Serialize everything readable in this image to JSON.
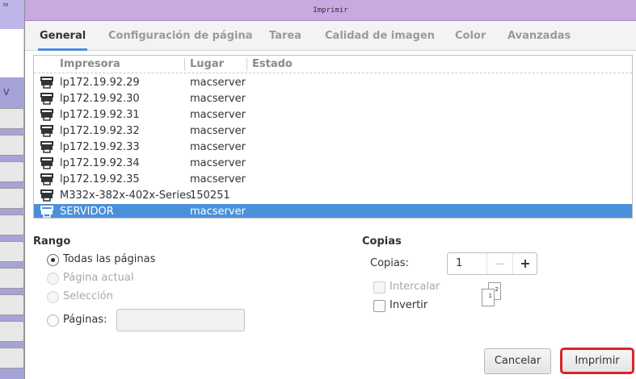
{
  "window": {
    "title": "Imprimir",
    "background_tag": "In",
    "background_letter": "V"
  },
  "tabs": [
    {
      "label": "General",
      "active": true
    },
    {
      "label": "Configuración de página",
      "active": false
    },
    {
      "label": "Tarea",
      "active": false
    },
    {
      "label": "Calidad de imagen",
      "active": false
    },
    {
      "label": "Color",
      "active": false
    },
    {
      "label": "Avanzadas",
      "active": false
    }
  ],
  "printer_list": {
    "columns": {
      "name": "Impresora",
      "location": "Lugar",
      "status": "Estado"
    },
    "rows": [
      {
        "name": "lp172.19.92.29",
        "location": "macserver",
        "selected": false
      },
      {
        "name": "lp172.19.92.30",
        "location": "macserver",
        "selected": false
      },
      {
        "name": "lp172.19.92.31",
        "location": "macserver",
        "selected": false
      },
      {
        "name": "lp172.19.92.32",
        "location": "macserver",
        "selected": false
      },
      {
        "name": "lp172.19.92.33",
        "location": "macserver",
        "selected": false
      },
      {
        "name": "lp172.19.92.34",
        "location": "macserver",
        "selected": false
      },
      {
        "name": "lp172.19.92.35",
        "location": "macserver",
        "selected": false
      },
      {
        "name": "M332x-382x-402x-Series",
        "location": "150251",
        "selected": false
      },
      {
        "name": "SERVIDOR",
        "location": "macserver",
        "selected": true
      }
    ],
    "row_icon": "printer-icon"
  },
  "range": {
    "title": "Rango",
    "options": {
      "all": {
        "label": "Todas las páginas",
        "checked": true,
        "enabled": true
      },
      "current": {
        "label": "Página actual",
        "checked": false,
        "enabled": false
      },
      "selection": {
        "label": "Selección",
        "checked": false,
        "enabled": false
      },
      "pages": {
        "label": "Páginas:",
        "checked": false,
        "enabled": true
      }
    },
    "pages_value": ""
  },
  "copies": {
    "title": "Copias",
    "label": "Copias:",
    "value": "1",
    "minus": "−",
    "plus": "+",
    "collate": {
      "label": "Intercalar",
      "checked": false,
      "enabled": false
    },
    "reverse": {
      "label": "Invertir",
      "checked": false,
      "enabled": true
    },
    "sheet_labels": [
      "1",
      "2"
    ]
  },
  "buttons": {
    "cancel": "Cancelar",
    "print": "Imprimir"
  },
  "colors": {
    "selection": "#4a90d9",
    "highlight_border": "#d9242a",
    "titlebar": "#c8a9e0"
  }
}
